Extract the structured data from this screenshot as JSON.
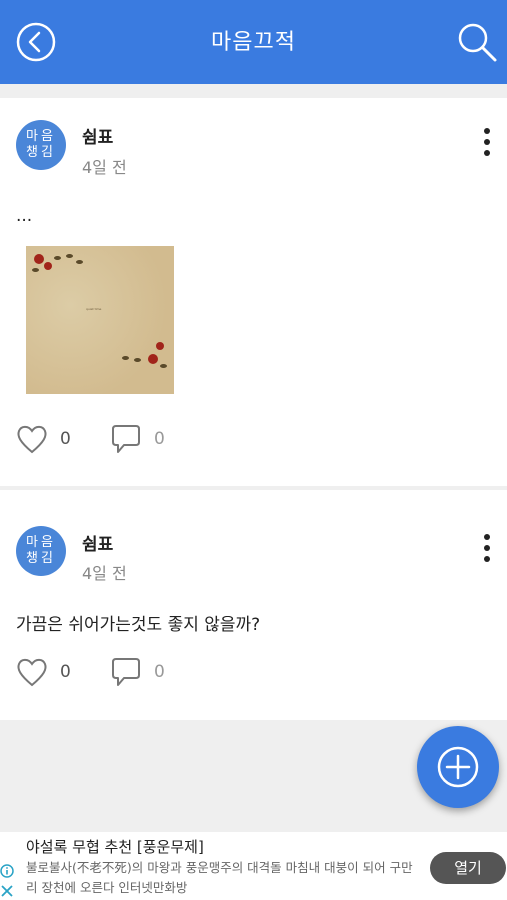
{
  "header": {
    "title": "마음끄적"
  },
  "posts": [
    {
      "avatar_text": "마음챙김",
      "author": "쉼표",
      "time": "4일 전",
      "content": "...",
      "likes": "0",
      "comments": "0",
      "has_image": true,
      "image_text": "quiet time"
    },
    {
      "avatar_text": "마음챙김",
      "author": "쉼표",
      "time": "4일 전",
      "content": "가끔은 쉬어가는것도 좋지 않을까?",
      "likes": "0",
      "comments": "0",
      "has_image": false
    }
  ],
  "ad": {
    "title": "야설록 무협 추천 [풍운무제]",
    "description": "불로불사(不老不死)의 마왕과 풍운맹주의 대격돌 마침내 대붕이 되어 구만리 장천에 오른다 인터넷만화방",
    "open_label": "열기"
  },
  "colors": {
    "primary": "#3a7be0",
    "avatar": "#4a86d8"
  },
  "icons": {
    "back": "chevron-left-circle-icon",
    "search": "search-icon",
    "more": "more-vertical-icon",
    "like": "heart-outline-icon",
    "comment": "speech-bubble-icon",
    "fab": "plus-circle-icon",
    "info": "info-icon",
    "close": "close-icon"
  }
}
